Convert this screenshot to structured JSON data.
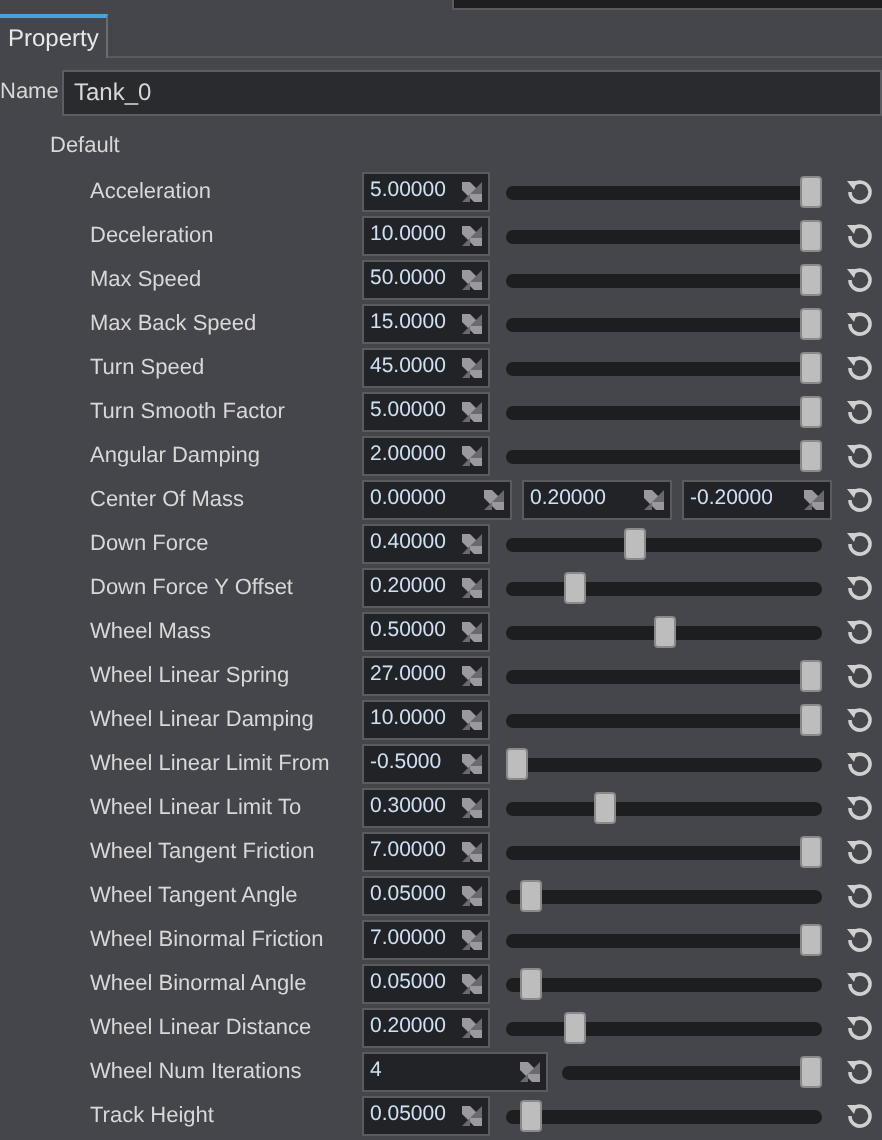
{
  "tabs": [
    {
      "label": "Property",
      "selected": true
    }
  ],
  "name_field": {
    "label": "Name",
    "value": "Tank_0"
  },
  "group": {
    "title": "Default"
  },
  "properties": [
    {
      "label": "Acceleration",
      "kind": "slider",
      "value": "5.00000",
      "level": 1
    },
    {
      "label": "Deceleration",
      "kind": "slider",
      "value": "10.0000",
      "level": 1
    },
    {
      "label": "Max Speed",
      "kind": "slider",
      "value": "50.0000",
      "level": 1
    },
    {
      "label": "Max Back Speed",
      "kind": "slider",
      "value": "15.0000",
      "level": 1
    },
    {
      "label": "Turn Speed",
      "kind": "slider",
      "value": "45.0000",
      "level": 1
    },
    {
      "label": "Turn Smooth Factor",
      "kind": "slider",
      "value": "5.00000",
      "level": 1
    },
    {
      "label": "Angular Damping",
      "kind": "slider",
      "value": "2.00000",
      "level": 1
    },
    {
      "label": "Center Of Mass",
      "kind": "vector",
      "values": [
        "0.00000",
        "0.20000",
        "-0.20000"
      ]
    },
    {
      "label": "Down Force",
      "kind": "slider",
      "value": "0.40000",
      "level": 0.4
    },
    {
      "label": "Down Force Y Offset",
      "kind": "slider",
      "value": "0.20000",
      "level": 0.2
    },
    {
      "label": "Wheel Mass",
      "kind": "slider",
      "value": "0.50000",
      "level": 0.5
    },
    {
      "label": "Wheel Linear Spring",
      "kind": "slider",
      "value": "27.0000",
      "level": 1
    },
    {
      "label": "Wheel Linear Damping",
      "kind": "slider",
      "value": "10.0000",
      "level": 1
    },
    {
      "label": "Wheel Linear Limit From",
      "kind": "slider",
      "value": "-0.5000",
      "level": 0
    },
    {
      "label": "Wheel Linear Limit To",
      "kind": "slider",
      "value": "0.30000",
      "level": 0.3
    },
    {
      "label": "Wheel Tangent Friction",
      "kind": "slider",
      "value": "7.00000",
      "level": 1
    },
    {
      "label": "Wheel Tangent Angle",
      "kind": "slider",
      "value": "0.05000",
      "level": 0.05
    },
    {
      "label": "Wheel Binormal Friction",
      "kind": "slider",
      "value": "7.00000",
      "level": 1
    },
    {
      "label": "Wheel Binormal Angle",
      "kind": "slider",
      "value": "0.05000",
      "level": 0.05
    },
    {
      "label": "Wheel Linear Distance",
      "kind": "slider",
      "value": "0.20000",
      "level": 0.2
    },
    {
      "label": "Wheel Num Iterations",
      "kind": "int_slider",
      "value": "4",
      "level": 1
    },
    {
      "label": "Track Height",
      "kind": "slider",
      "value": "0.05000",
      "level": 0.05
    }
  ]
}
